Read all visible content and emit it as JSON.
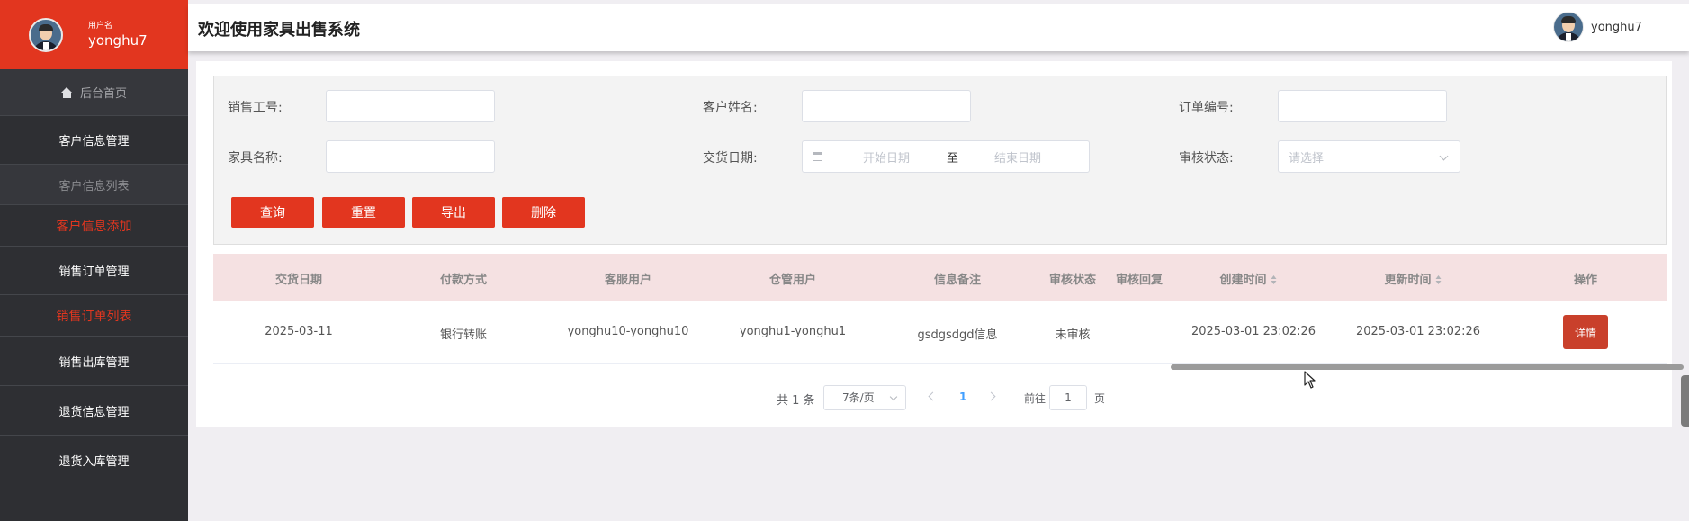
{
  "sidebar": {
    "user_caption": "用户名",
    "user_name": "yonghu7",
    "items": [
      {
        "label": "后台首页"
      },
      {
        "label": "客户信息管理"
      },
      {
        "label": "客户信息列表"
      },
      {
        "label": "客户信息添加"
      },
      {
        "label": "销售订单管理"
      },
      {
        "label": "销售订单列表"
      },
      {
        "label": "销售出库管理"
      },
      {
        "label": "退货信息管理"
      },
      {
        "label": "退货入库管理"
      }
    ]
  },
  "header": {
    "title": "欢迎使用家具出售系统",
    "user_name": "yonghu7"
  },
  "search": {
    "sales_id_label": "销售工号:",
    "customer_name_label": "客户姓名:",
    "order_no_label": "订单编号:",
    "furniture_name_label": "家具名称:",
    "delivery_date_label": "交货日期:",
    "start_date_placeholder": "开始日期",
    "date_separator": "至",
    "end_date_placeholder": "结束日期",
    "review_status_label": "审核状态:",
    "review_status_placeholder": "请选择",
    "buttons": {
      "query": "查询",
      "reset": "重置",
      "export": "导出",
      "delete": "删除"
    }
  },
  "table": {
    "columns": [
      "交货日期",
      "付款方式",
      "客服用户",
      "仓管用户",
      "信息备注",
      "审核状态",
      "审核回复",
      "创建时间",
      "更新时间",
      "操作"
    ],
    "rows": [
      {
        "delivery_date": "2025-03-11",
        "payment_method": "银行转账",
        "service_user": "yonghu10-yonghu10",
        "warehouse_user": "yonghu1-yonghu1",
        "remark": "gsdgsdgd信息",
        "review_status": "未审核",
        "review_reply": "",
        "created_at": "2025-03-01 23:02:26",
        "updated_at": "2025-03-01 23:02:26",
        "action_label": "详情"
      }
    ]
  },
  "pagination": {
    "total_text": "共 1 条",
    "page_size": "7条/页",
    "current_page": "1",
    "goto_label": "前往",
    "goto_value": "1",
    "page_suffix": "页"
  },
  "colors": {
    "accent": "#e2361f",
    "sidebar_bg": "#2e2f33",
    "table_header_bg": "#f5e1e2",
    "detail_button": "#c9402b",
    "pager_active": "#409eff"
  }
}
